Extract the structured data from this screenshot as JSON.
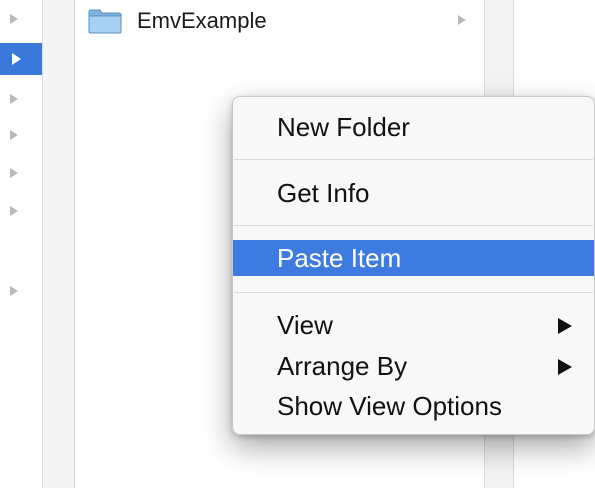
{
  "colors": {
    "selection": "#3a78d9",
    "menu_highlight": "#3d7be0",
    "folder_blue": "#8fc1ea"
  },
  "column_left": {
    "rows": [
      {
        "icon": "disclosure-triangle-icon",
        "selected": false
      },
      {
        "icon": "disclosure-triangle-icon",
        "selected": true
      },
      {
        "icon": "disclosure-triangle-icon",
        "selected": false
      },
      {
        "icon": "disclosure-triangle-icon",
        "selected": false
      },
      {
        "icon": "disclosure-triangle-icon",
        "selected": false
      },
      {
        "icon": "disclosure-triangle-icon",
        "selected": false
      },
      {
        "icon": "disclosure-triangle-icon",
        "selected": false
      }
    ]
  },
  "column_mid": {
    "items": [
      {
        "label": "EmvExample",
        "icon": "folder-icon",
        "has_children": true
      }
    ]
  },
  "context_menu": {
    "new_folder": "New Folder",
    "get_info": "Get Info",
    "paste_item": "Paste Item",
    "view": "View",
    "arrange_by": "Arrange By",
    "show_view_options": "Show View Options",
    "highlighted": "Paste Item"
  }
}
